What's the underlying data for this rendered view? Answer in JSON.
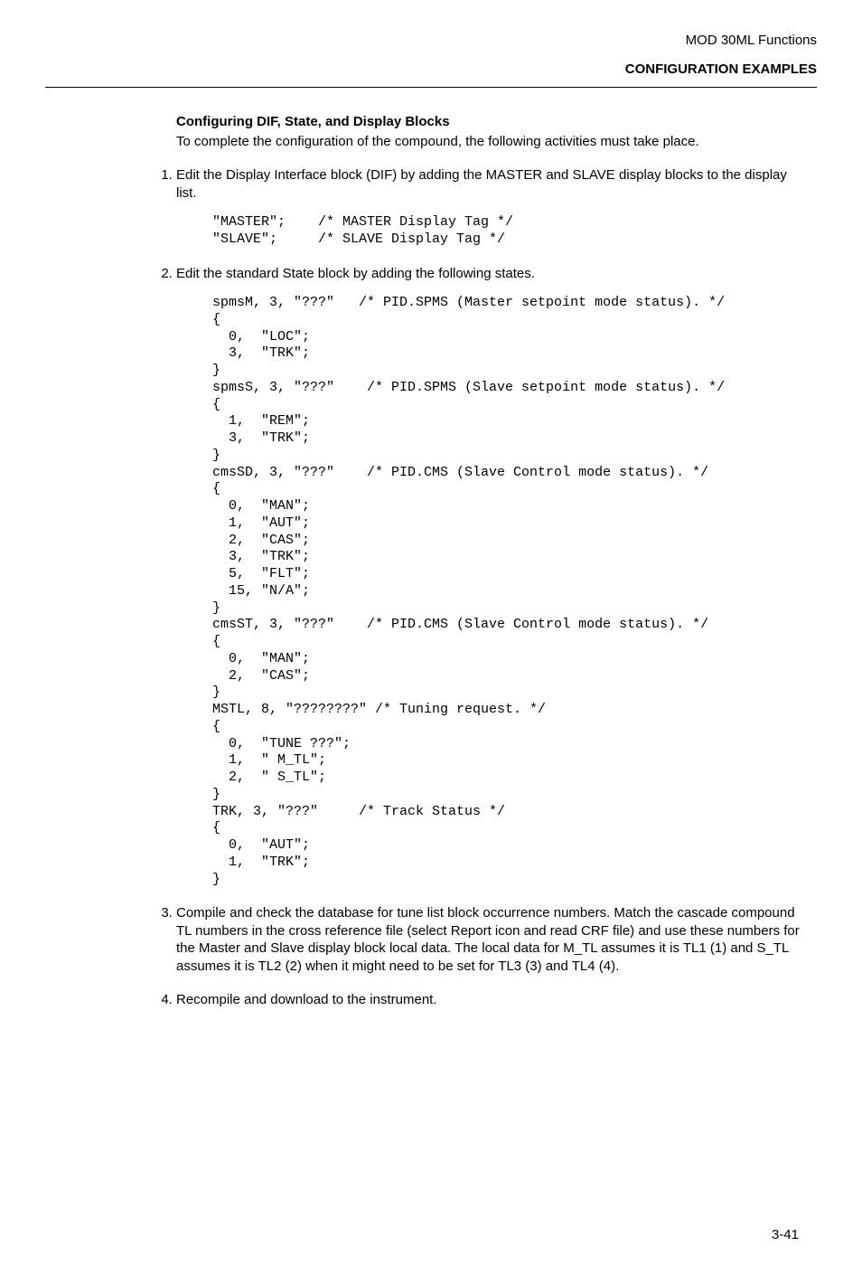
{
  "header": {
    "product": "MOD 30ML Functions",
    "section": "CONFIGURATION EXAMPLES"
  },
  "subhead": "Configuring DIF, State, and Display Blocks",
  "intro": "To complete the configuration of the compound, the following activities must take place.",
  "steps": {
    "s1": {
      "text": "Edit the Display Interface block (DIF) by adding the MASTER and SLAVE display blocks to the display list.",
      "code": "\"MASTER\";    /* MASTER Display Tag */\n\"SLAVE\";     /* SLAVE Display Tag */"
    },
    "s2": {
      "text": "Edit the standard State block by adding the following states.",
      "code": "spmsM, 3, \"???\"   /* PID.SPMS (Master setpoint mode status). */\n{\n  0,  \"LOC\";\n  3,  \"TRK\";\n}\nspmsS, 3, \"???\"    /* PID.SPMS (Slave setpoint mode status). */\n{\n  1,  \"REM\";\n  3,  \"TRK\";\n}\ncmsSD, 3, \"???\"    /* PID.CMS (Slave Control mode status). */\n{\n  0,  \"MAN\";\n  1,  \"AUT\";\n  2,  \"CAS\";\n  3,  \"TRK\";\n  5,  \"FLT\";\n  15, \"N/A\";\n}\ncmsST, 3, \"???\"    /* PID.CMS (Slave Control mode status). */\n{\n  0,  \"MAN\";\n  2,  \"CAS\";\n}\nMSTL, 8, \"????????\" /* Tuning request. */\n{\n  0,  \"TUNE ???\";\n  1,  \" M_TL\";\n  2,  \" S_TL\";\n}\nTRK, 3, \"???\"     /* Track Status */\n{\n  0,  \"AUT\";\n  1,  \"TRK\";\n}"
    },
    "s3": {
      "text": "Compile and check the database for tune list block occurrence numbers.  Match the cascade compound TL numbers in the cross reference file (select Report icon and read CRF file) and use these numbers for the Master and Slave display block local data.  The local data for M_TL assumes it is TL1 (1) and S_TL assumes it is TL2 (2) when it might need to be set for TL3 (3) and TL4 (4)."
    },
    "s4": {
      "text": "Recompile and download to the instrument."
    }
  },
  "page_number": "3-41"
}
